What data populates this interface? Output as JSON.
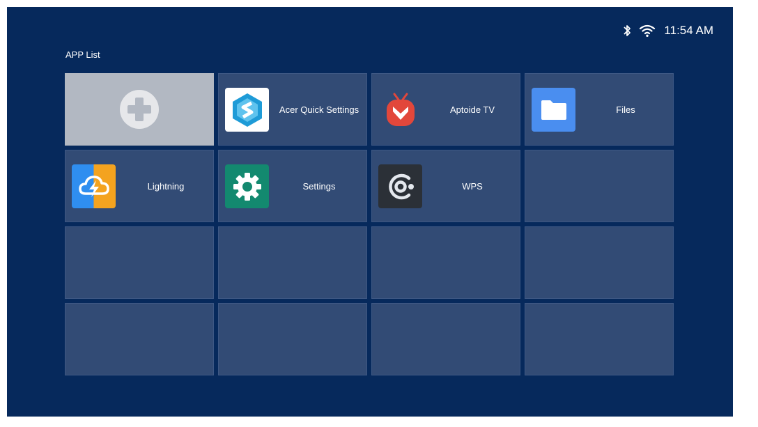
{
  "status": {
    "time": "11:54 AM",
    "icons": [
      "bluetooth-icon",
      "wifi-icon"
    ]
  },
  "section_title": "APP List",
  "tiles": [
    {
      "type": "add",
      "icon": "add-icon"
    },
    {
      "type": "app",
      "label": "Acer Quick Settings",
      "icon": "acer-quick-settings-icon",
      "icon_color": "#ffffff"
    },
    {
      "type": "app",
      "label": "Aptoide TV",
      "icon": "aptoide-tv-icon",
      "icon_color": "#e2473b"
    },
    {
      "type": "app",
      "label": "Files",
      "icon": "files-folder-icon",
      "icon_color": "#4a8ef0"
    },
    {
      "type": "app",
      "label": "Lightning",
      "icon": "lightning-icon",
      "icon_color": "#f4a31f"
    },
    {
      "type": "app",
      "label": "Settings",
      "icon": "settings-gear-icon",
      "icon_color": "#13896f"
    },
    {
      "type": "app",
      "label": "WPS",
      "icon": "wps-icon",
      "icon_color": "#2b3037"
    },
    {
      "type": "empty"
    },
    {
      "type": "empty"
    },
    {
      "type": "empty"
    },
    {
      "type": "empty"
    },
    {
      "type": "empty"
    },
    {
      "type": "empty"
    },
    {
      "type": "empty"
    },
    {
      "type": "empty"
    },
    {
      "type": "empty"
    }
  ],
  "colors": {
    "background": "#06295c",
    "tile": "#324b75",
    "add_tile": "#b2b8c2"
  }
}
